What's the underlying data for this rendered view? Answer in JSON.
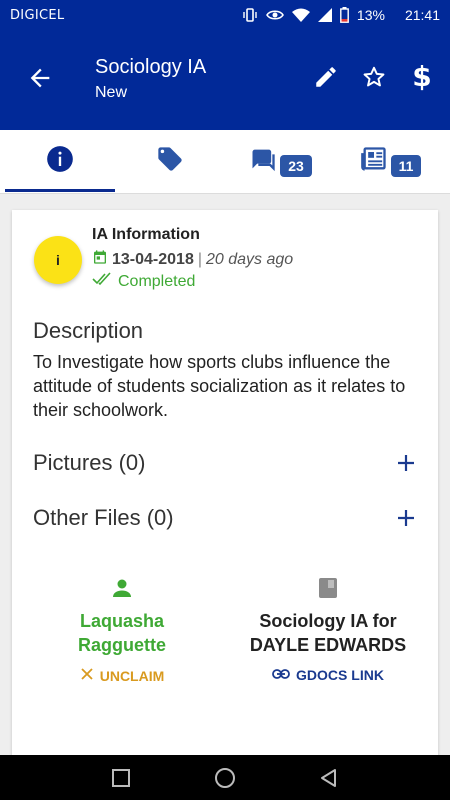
{
  "status_bar": {
    "carrier": "DIGICEL",
    "battery": "13%",
    "time": "21:41"
  },
  "app_bar": {
    "title": "Sociology IA",
    "subtitle": "New",
    "dollar_symbol": "$",
    "icons": [
      "back-arrow-icon",
      "edit-pencil-icon",
      "star-outline-icon",
      "dollar-icon"
    ]
  },
  "tabs": [
    {
      "icon": "info-icon",
      "badge": null,
      "active": true
    },
    {
      "icon": "tag-icon",
      "badge": null,
      "active": false
    },
    {
      "icon": "chat-icon",
      "badge": "23",
      "active": false
    },
    {
      "icon": "news-icon",
      "badge": "11",
      "active": false
    }
  ],
  "info": {
    "circle_label": "i",
    "title": "IA Information",
    "date": "13-04-2018",
    "separator": "|",
    "ago": "20 days ago",
    "status": "Completed"
  },
  "description": {
    "label": "Description",
    "text": " To Investigate how sports clubs influence the attitude of students socialization as it relates to their schoolwork."
  },
  "pictures": {
    "label": "Pictures (0)"
  },
  "other_files": {
    "label": "Other Files (0)"
  },
  "person": {
    "name": "Laquasha Ragguette",
    "action": "UNCLAIM"
  },
  "doc": {
    "title": "Sociology IA for DAYLE EDWARDS",
    "link_label": "GDOCS LINK"
  },
  "colors": {
    "primary": "#012998",
    "accent_green": "#3fa935",
    "accent_yellow": "#fbe216",
    "unclaim_orange": "#d99a1f",
    "badge_blue": "#2c56a6"
  }
}
